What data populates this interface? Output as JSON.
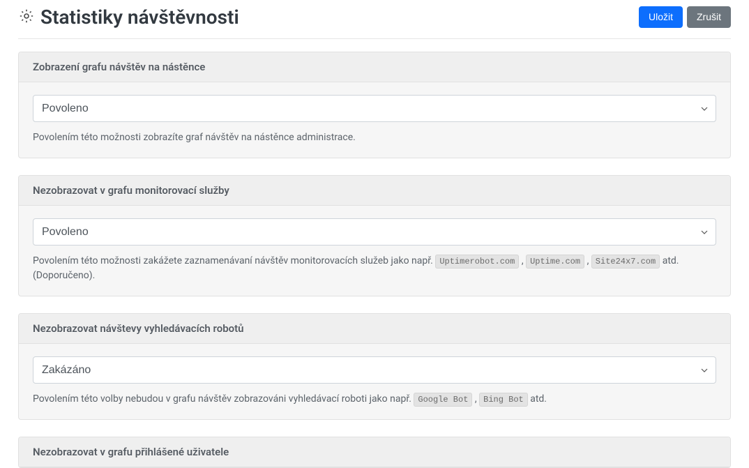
{
  "header": {
    "title": "Statistiky návštěvnosti",
    "save_label": "Uložit",
    "cancel_label": "Zrušit"
  },
  "options": {
    "allowed": "Povoleno",
    "disallowed": "Zakázáno"
  },
  "panel1": {
    "title": "Zobrazení grafu návštěv na nástěnce",
    "selected": "Povoleno",
    "hint": "Povolením této možnosti zobrazíte graf návštěv na nástěnce administrace."
  },
  "panel2": {
    "title": "Nezobrazovat v grafu monitorovací služby",
    "selected": "Povoleno",
    "hint_pre": "Povolením této možnosti zakážete zaznamenávaní návštěv monitorovacích služeb jako např. ",
    "code1": "Uptimerobot.com",
    "sep1": ", ",
    "code2": "Uptime.com",
    "sep2": ", ",
    "code3": "Site24x7.com",
    "hint_post": " atd. (Doporučeno)."
  },
  "panel3": {
    "title": "Nezobrazovat návštevy vyhledávacích robotů",
    "selected": "Zakázáno",
    "hint_pre": "Povolením této volby nebudou v grafu návštěv zobrazováni vyhledávací roboti jako např. ",
    "code1": "Google Bot",
    "sep1": ", ",
    "code2": "Bing Bot",
    "hint_post": " atd."
  },
  "panel4": {
    "title": "Nezobrazovat v grafu přihlášené uživatele"
  }
}
